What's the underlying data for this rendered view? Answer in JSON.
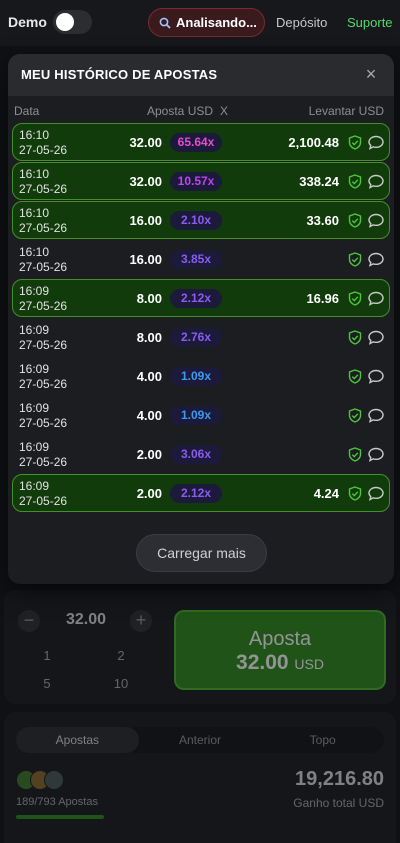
{
  "topbar": {
    "demo_label": "Demo",
    "analise_label": "Analisando...",
    "deposito_label": "Depósito",
    "suporte_label": "Suporte"
  },
  "modal": {
    "title": "MEU HISTÓRICO DE APOSTAS",
    "close_glyph": "×",
    "columns": {
      "date": "Data",
      "stake": "Aposta USD",
      "mult": "X",
      "cashout": "Levantar USD"
    },
    "rows": [
      {
        "time": "16:10",
        "date": "27-05-26",
        "stake": "32.00",
        "mult": "65.64x",
        "mult_color": "#e64bd0",
        "cashout": "2,100.48",
        "win": true
      },
      {
        "time": "16:10",
        "date": "27-05-26",
        "stake": "32.00",
        "mult": "10.57x",
        "mult_color": "#c142ef",
        "cashout": "338.24",
        "win": true
      },
      {
        "time": "16:10",
        "date": "27-05-26",
        "stake": "16.00",
        "mult": "2.10x",
        "mult_color": "#8a5cf0",
        "cashout": "33.60",
        "win": true
      },
      {
        "time": "16:10",
        "date": "27-05-26",
        "stake": "16.00",
        "mult": "3.85x",
        "mult_color": "#8a5cf0",
        "cashout": "",
        "win": false
      },
      {
        "time": "16:09",
        "date": "27-05-26",
        "stake": "8.00",
        "mult": "2.12x",
        "mult_color": "#8a5cf0",
        "cashout": "16.96",
        "win": true
      },
      {
        "time": "16:09",
        "date": "27-05-26",
        "stake": "8.00",
        "mult": "2.76x",
        "mult_color": "#8a5cf0",
        "cashout": "",
        "win": false
      },
      {
        "time": "16:09",
        "date": "27-05-26",
        "stake": "4.00",
        "mult": "1.09x",
        "mult_color": "#3a9bf0",
        "cashout": "",
        "win": false
      },
      {
        "time": "16:09",
        "date": "27-05-26",
        "stake": "4.00",
        "mult": "1.09x",
        "mult_color": "#3a9bf0",
        "cashout": "",
        "win": false
      },
      {
        "time": "16:09",
        "date": "27-05-26",
        "stake": "2.00",
        "mult": "3.06x",
        "mult_color": "#8a5cf0",
        "cashout": "",
        "win": false
      },
      {
        "time": "16:09",
        "date": "27-05-26",
        "stake": "2.00",
        "mult": "2.12x",
        "mult_color": "#8a5cf0",
        "cashout": "4.24",
        "win": true
      }
    ],
    "load_more_label": "Carregar mais"
  },
  "game": {
    "stake_value": "32.00",
    "minus_glyph": "−",
    "plus_glyph": "+",
    "quick_amounts": [
      "1",
      "2",
      "5",
      "10"
    ],
    "bet_label": "Aposta",
    "bet_amount": "32.00",
    "bet_currency": "USD"
  },
  "stats": {
    "tabs": [
      "Apostas",
      "Anterior",
      "Topo"
    ],
    "bets_count": "189/793",
    "bets_label": "Apostas",
    "total_value": "19,216.80",
    "total_label": "Ganho total USD",
    "progress_fraction": 0.24
  },
  "colors": {
    "accent_green": "#55d96a",
    "win_row_bg": "#123b0c",
    "win_row_border": "#438f2a",
    "icon_green": "#4cc73a"
  }
}
